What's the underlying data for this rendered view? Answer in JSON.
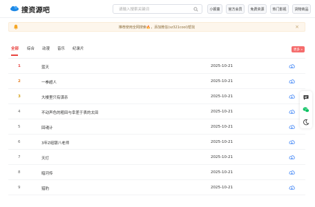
{
  "header": {
    "brand": "搜资源吧",
    "search_placeholder": "请输入搜索关键词",
    "nav": [
      "小报童",
      "官方会员",
      "免费资源",
      "热门影视",
      "货物商品"
    ]
  },
  "notice": {
    "text": "推荐使用全网搜索🔥，添加微信(sz321cool)帮找",
    "close": "×"
  },
  "tabs": [
    {
      "label": "全部",
      "active": true
    },
    {
      "label": "综合",
      "active": false
    },
    {
      "label": "动漫",
      "active": false
    },
    {
      "label": "音乐",
      "active": false
    },
    {
      "label": "纪录片",
      "active": false
    }
  ],
  "more_label": "更多 »",
  "rows": [
    {
      "rank": "1",
      "title": "蓝天",
      "date": "2025-10-21"
    },
    {
      "rank": "2",
      "title": "一拳超人",
      "date": "2025-10-21"
    },
    {
      "rank": "3",
      "title": "大楼里只有谋杀",
      "date": "2025-10-21"
    },
    {
      "rank": "4",
      "title": "不动声色的粗田与幸差于表的太田",
      "date": "2025-10-21"
    },
    {
      "rank": "5",
      "title": "回魂计",
      "date": "2025-10-21"
    },
    {
      "rank": "6",
      "title": "3年Z组银八老师",
      "date": "2025-10-21"
    },
    {
      "rank": "7",
      "title": "天灯",
      "date": "2025-10-21"
    },
    {
      "rank": "8",
      "title": "暗河传",
      "date": "2025-10-21"
    },
    {
      "rank": "9",
      "title": "猎豹",
      "date": "2025-10-21"
    }
  ],
  "colors": {
    "accent": "#e8413d",
    "brand_logo": "#1e88e5",
    "download_icon": "#3b82f6",
    "notice_bg": "#fdf6ec",
    "wechat_green": "#07c160"
  },
  "icons": {
    "logo": "cloud-logo-icon",
    "search": "search-icon",
    "notice": "bell-icon",
    "download": "cloud-download-icon",
    "side": [
      "message-icon",
      "wechat-icon",
      "moon-icon"
    ]
  }
}
